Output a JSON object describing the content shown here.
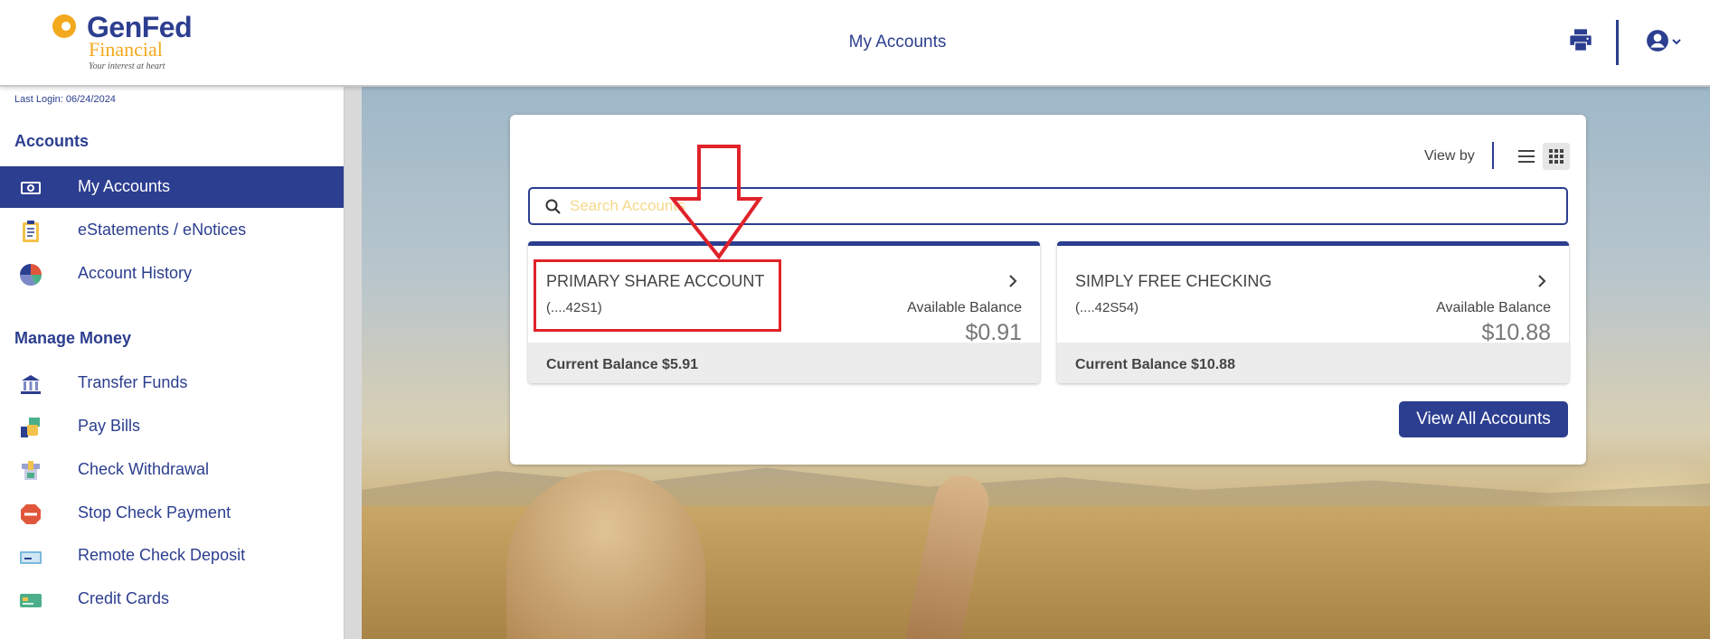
{
  "header": {
    "logo": {
      "name": "GenFed",
      "sub": "Financial",
      "tagline": "Your interest at heart"
    },
    "title": "My Accounts",
    "icons": {
      "print": "print-icon",
      "profile": "user-circle-icon"
    }
  },
  "sidebar": {
    "last_login": "Last Login: 06/24/2024",
    "accounts_heading": "Accounts",
    "accounts_items": [
      {
        "label": "My Accounts",
        "icon": "cash-icon"
      },
      {
        "label": "eStatements / eNotices",
        "icon": "clipboard-icon"
      },
      {
        "label": "Account History",
        "icon": "pie-chart-icon"
      }
    ],
    "money_heading": "Manage Money",
    "money_items": [
      {
        "label": "Transfer Funds",
        "icon": "bank-icon"
      },
      {
        "label": "Pay Bills",
        "icon": "bill-pay-icon"
      },
      {
        "label": "Check Withdrawal",
        "icon": "check-withdrawal-icon"
      },
      {
        "label": "Stop Check Payment",
        "icon": "stop-sign-icon"
      },
      {
        "label": "Remote Check Deposit",
        "icon": "check-deposit-icon"
      },
      {
        "label": "Credit Cards",
        "icon": "credit-card-icon"
      }
    ]
  },
  "main": {
    "view_by": "View by",
    "search": {
      "placeholder": "Search Accounts",
      "value": ""
    },
    "accounts": [
      {
        "name": "PRIMARY SHARE ACCOUNT",
        "number": "(....42S1)",
        "available_label": "Available Balance",
        "available": "$0.91",
        "current": "Current Balance $5.91"
      },
      {
        "name": "SIMPLY FREE CHECKING",
        "number": "(....42S54)",
        "available_label": "Available Balance",
        "available": "$10.88",
        "current": "Current Balance $10.88"
      }
    ],
    "view_all": "View All Accounts"
  },
  "colors": {
    "brand": "#2c3e8f",
    "accent": "#f3a91e",
    "annotation": "#e0222a"
  }
}
